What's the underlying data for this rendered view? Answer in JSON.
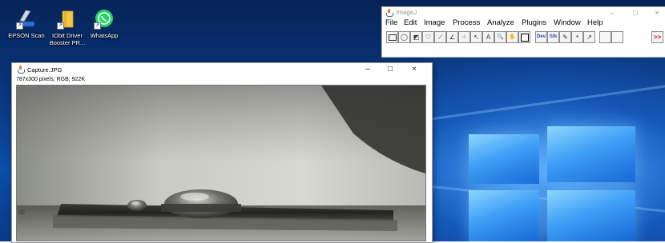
{
  "desktop": {
    "icons": [
      {
        "label": "EPSON Scan"
      },
      {
        "label": "IObit Driver Booster PR..."
      },
      {
        "label": "WhatsApp"
      }
    ]
  },
  "imagej": {
    "title": "ImageJ",
    "menu": [
      "File",
      "Edit",
      "Image",
      "Process",
      "Analyze",
      "Plugins",
      "Window",
      "Help"
    ],
    "tool_glyphs": {
      "rect": "",
      "oval": "◯",
      "polygon": "◩",
      "freehand": "♡",
      "line": "⟋",
      "angle": "∠",
      "point": "⁘",
      "wand": "↖",
      "text": "A",
      "magnifier": "🔍",
      "hand": "✋",
      "color": "",
      "dev": "Dev",
      "stk": "Stk",
      "pencil": "✎",
      "brush": "●",
      "arrow": "↗",
      "more": ">>"
    },
    "window_controls": {
      "minimize": "–",
      "maximize": "□",
      "close": "×"
    }
  },
  "image_window": {
    "title": "Capture.JPG",
    "info": "787x300 pixels; RGB; 922K",
    "window_controls": {
      "minimize": "–",
      "maximize": "□",
      "close": "×"
    }
  },
  "colors": {
    "desktop_dark": "#062357",
    "desktop_light": "#3e9ef5",
    "java_orange": "#e8761a",
    "java_blue": "#2b5aa6",
    "more_red": "#c31919"
  }
}
